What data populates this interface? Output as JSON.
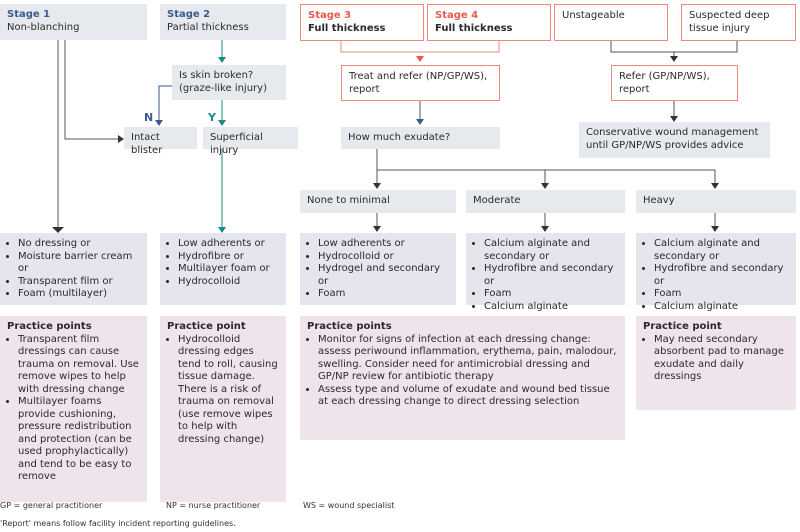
{
  "colors": {
    "stage_blue": "#3b5a8e",
    "stage_red": "#ec5a4c",
    "teal": "#1a8a8a",
    "grey_box": "#e6eaee",
    "dressing_box": "#e4e5ed",
    "practice_box": "#efe4ec"
  },
  "stages": [
    {
      "title": "Stage 1",
      "desc": "Non-blanching"
    },
    {
      "title": "Stage 2",
      "desc": "Partial thickness"
    },
    {
      "title": "Stage 3",
      "desc": "Full thickness"
    },
    {
      "title": "Stage 4",
      "desc": "Full thickness"
    },
    {
      "title": "",
      "desc": "Unstageable"
    },
    {
      "title": "",
      "desc": "Suspected deep tissue injury"
    }
  ],
  "nodes": {
    "skin_broken": "Is skin broken? (graze-like injury)",
    "n_label": "N",
    "y_label": "Y",
    "intact_blister": "Intact blister",
    "superficial": "Superficial injury",
    "treat_refer": "Treat and refer (NP/GP/WS), report",
    "exudate": "How much exudate?",
    "refer": "Refer (GP/NP/WS), report",
    "conservative": "Conservative wound management until GP/NP/WS provides advice",
    "none_minimal": "None to minimal",
    "moderate": "Moderate",
    "heavy": "Heavy"
  },
  "dressings": [
    [
      "No dressing or",
      "Moisture barrier cream or",
      "Transparent film or",
      "Foam (multilayer)"
    ],
    [
      "Low adherents or",
      "Hydrofibre or",
      "Multilayer foam or",
      "Hydrocolloid"
    ],
    [
      "Low adherents or",
      "Hydrocolloid or",
      "Hydrogel and secondary or",
      "Foam"
    ],
    [
      "Calcium alginate and secondary or",
      "Hydrofibre and secondary or",
      "Foam",
      "Calcium alginate"
    ],
    [
      "Calcium alginate and secondary or",
      "Hydrofibre and secondary or",
      "Foam",
      "Calcium alginate"
    ]
  ],
  "practice": [
    {
      "title": "Practice points",
      "items": [
        "Transparent film dressings can cause trauma on removal. Use remove wipes to help with dressing change",
        "Multilayer foams provide cushioning, pressure redistribution and protection (can be used prophylactically) and tend to be easy to remove"
      ]
    },
    {
      "title": "Practice point",
      "items": [
        "Hydrocolloid dressing edges tend to roll, causing tissue damage. There is a risk of trauma on removal (use remove wipes to help with dressing change)"
      ]
    },
    {
      "title": "Practice points",
      "items": [
        "Monitor for signs of infection at each dressing change: assess periwound inflammation, erythema, pain, malodour, swelling. Consider need for antimicrobial dressing and GP/NP review for antibiotic therapy",
        "Assess type and volume of exudate and wound bed tissue at each dressing change to direct dressing selection"
      ]
    },
    {
      "title": "Practice point",
      "items": [
        "May need secondary absorbent pad to manage exudate and daily dressings"
      ]
    }
  ],
  "footer": {
    "gp": "GP = general practitioner",
    "np": "NP = nurse practitioner",
    "ws": "WS = wound specialist",
    "report": "'Report' means follow facility incident reporting guidelines."
  }
}
